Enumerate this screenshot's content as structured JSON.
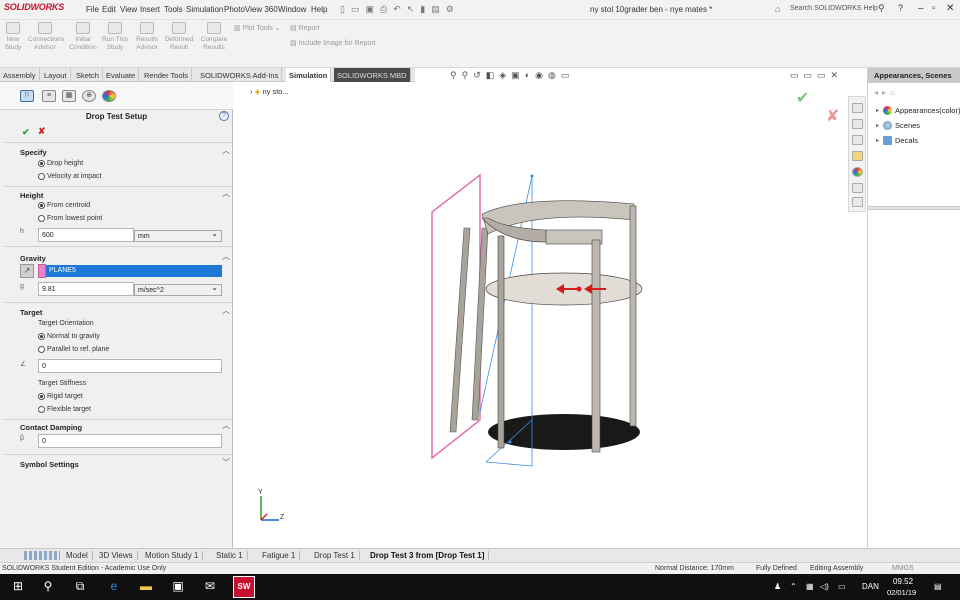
{
  "app": {
    "logo": "SOLIDWORKS",
    "menus": [
      "File",
      "Edit",
      "View",
      "Insert",
      "Tools",
      "Simulation",
      "PhotoView 360",
      "Window",
      "Help"
    ],
    "document_title": "ny stol 10grader ben - nye mates *",
    "search_placeholder": "Search SOLIDWORKS Help"
  },
  "ribbon": {
    "buttons": [
      "New Study",
      "Connections Advisor",
      "Initial Condition",
      "Run This Study",
      "Results Advisor",
      "Deformed Result",
      "Compare Results"
    ],
    "plot_tools": "Plot Tools",
    "report": "Report",
    "include_image": "Include Image for Report"
  },
  "command_tabs": [
    "Assembly",
    "Layout",
    "Sketch",
    "Evaluate",
    "Render Tools",
    "SOLIDWORKS Add-Ins",
    "Simulation",
    "SOLIDWORKS MBD"
  ],
  "property_manager": {
    "title": "Drop Test Setup",
    "specify": {
      "label": "Specify",
      "options": [
        "Drop height",
        "Velocity at impact"
      ],
      "selected": 0
    },
    "height": {
      "label": "Height",
      "options": [
        "From centroid",
        "From lowest point"
      ],
      "selected": 0,
      "value": "600",
      "unit": "mm"
    },
    "gravity": {
      "label": "Gravity",
      "reference": "PLANE5",
      "value": "9.81",
      "unit": "m/sec^2"
    },
    "target": {
      "label": "Target",
      "orientation_label": "Target Orientation",
      "orientation_options": [
        "Normal to gravity",
        "Parallel to ref. plane"
      ],
      "orientation_selected": 0,
      "angle_value": "0",
      "stiffness_label": "Target Stiffness",
      "stiffness_options": [
        "Rigid target",
        "Flexible target"
      ],
      "stiffness_selected": 0
    },
    "contact_damping": {
      "label": "Contact Damping",
      "value": "0"
    },
    "symbol_settings": {
      "label": "Symbol Settings"
    }
  },
  "viewport": {
    "tree_root": "ny sto...",
    "axis_x": "Z",
    "axis_y": "Y"
  },
  "task_pane": {
    "title": "Appearances, Scenes",
    "items": [
      "Appearances(color)",
      "Scenes",
      "Decals"
    ]
  },
  "bottom_tabs": [
    "Model",
    "3D Views",
    "Motion Study 1",
    "Static 1",
    "Fatigue 1",
    "Drop Test 1",
    "Drop Test 3 from [Drop Test 1]"
  ],
  "status": {
    "edition": "SOLIDWORKS Student Edition - Academic Use Only",
    "distance": "Normal Distance: 170mm",
    "state": "Fully Defined",
    "mode": "Editing Assembly",
    "units": "MMGS"
  },
  "taskbar": {
    "language": "DAN",
    "time": "09.52",
    "date": "02/01/19"
  },
  "colors": {
    "selection": "#1e78d7",
    "plane": "#e070b0",
    "arrow": "#d81c1c",
    "solidworks_red": "#c8102e"
  }
}
